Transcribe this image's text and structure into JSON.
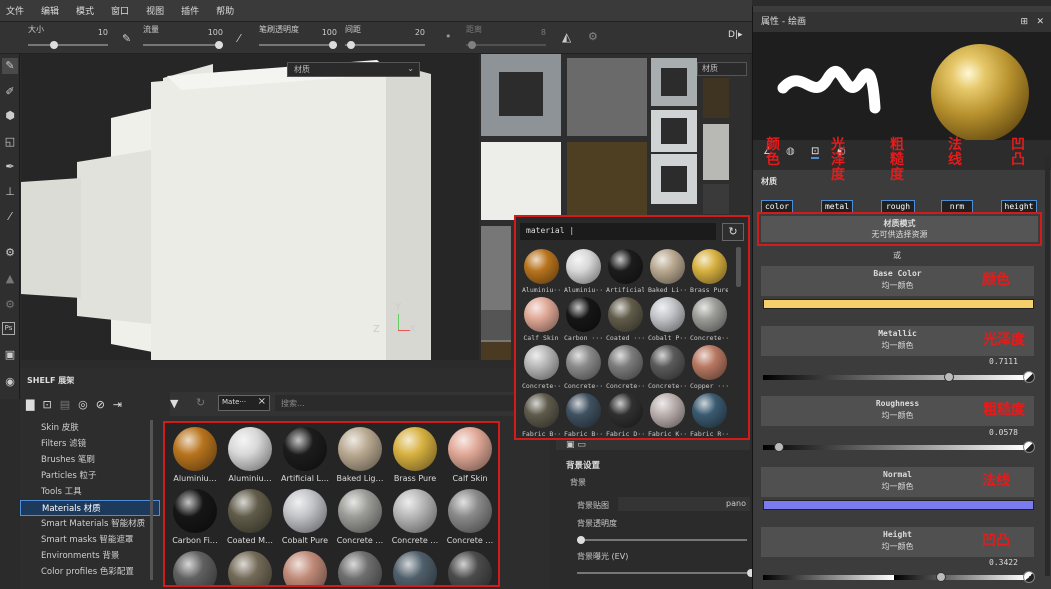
{
  "menu": [
    "文件",
    "编辑",
    "模式",
    "窗口",
    "视图",
    "插件",
    "帮助"
  ],
  "toolbar": {
    "size_label": "大小",
    "size_value": "10",
    "flow_label": "流量",
    "flow_value": "100",
    "stroke_opacity_label": "笔刷透明度",
    "stroke_opacity_value": "100",
    "spacing_label": "间距",
    "spacing_value": "20",
    "distance_label": "距离",
    "distance_value": "8"
  },
  "viewport": {
    "dropdown": "材质",
    "axis_y": "Y",
    "axis_z": "Z",
    "axis_x": "X"
  },
  "uv_view": {
    "dropdown": "材质"
  },
  "shelf": {
    "title": "SHELF 展架",
    "filter_tag": "Mate···",
    "search_placeholder": "搜索...",
    "categories": [
      "Skin 皮肤",
      "Filters 滤镜",
      "Brushes 笔刷",
      "Particles 粒子",
      "Tools 工具",
      "Materials 材质",
      "Smart Materials 智能材质",
      "Smart masks 智能遮罩",
      "Environments 背景",
      "Color profiles 色彩配置"
    ],
    "tiles": [
      {
        "label": "Aluminiu…",
        "color": "#b8741e"
      },
      {
        "label": "Aluminiu…",
        "color": "#d8d8d8"
      },
      {
        "label": "Artificial L…",
        "color": "#1c1c1c"
      },
      {
        "label": "Baked Lig…",
        "color": "#b9a991"
      },
      {
        "label": "Brass Pure",
        "color": "#d7b140"
      },
      {
        "label": "Calf Skin",
        "color": "#e0a896"
      },
      {
        "label": "Carbon Fi…",
        "color": "#161616"
      },
      {
        "label": "Coated M…",
        "color": "#615c4a"
      },
      {
        "label": "Cobalt Pure",
        "color": "#c2c4c8"
      },
      {
        "label": "Concrete …",
        "color": "#9c9c98"
      },
      {
        "label": "Concrete …",
        "color": "#b8b8b8"
      },
      {
        "label": "Concrete …",
        "color": "#8a8a8a"
      },
      {
        "label": "",
        "color": "#606060"
      },
      {
        "label": "",
        "color": "#736957"
      },
      {
        "label": "",
        "color": "#c08a78"
      },
      {
        "label": "",
        "color": "#6e6e6e"
      },
      {
        "label": "",
        "color": "#4f5f6b"
      },
      {
        "label": "",
        "color": "#4b4b4b"
      }
    ]
  },
  "popup": {
    "query": "material |",
    "items": [
      {
        "label": "Aluminiu···",
        "color": "#b8741e"
      },
      {
        "label": "Aluminiu···",
        "color": "#d8d8d8"
      },
      {
        "label": "Artificial",
        "color": "#1c1c1c"
      },
      {
        "label": "Baked Li···",
        "color": "#b9a991"
      },
      {
        "label": "Brass Pure",
        "color": "#d7b140"
      },
      {
        "label": "Calf Skin",
        "color": "#e0a896"
      },
      {
        "label": "Carbon ···",
        "color": "#161616"
      },
      {
        "label": "Coated ···",
        "color": "#615c4a"
      },
      {
        "label": "Cobalt P···",
        "color": "#c2c4c8"
      },
      {
        "label": "Concrete···",
        "color": "#9c9c98"
      },
      {
        "label": "Concrete···",
        "color": "#b8b8b8"
      },
      {
        "label": "Concrete···",
        "color": "#8a8a8a"
      },
      {
        "label": "Concrete···",
        "color": "#7c7c7c"
      },
      {
        "label": "Concrete···",
        "color": "#5a5a5a"
      },
      {
        "label": "Copper ···",
        "color": "#b87862"
      },
      {
        "label": "Fabric B···",
        "color": "#5e5a4c"
      },
      {
        "label": "Fabric B···",
        "color": "#3f5160"
      },
      {
        "label": "Fabric D···",
        "color": "#303030"
      },
      {
        "label": "Fabric K···",
        "color": "#bbb0ae"
      },
      {
        "label": "Fabric R···",
        "color": "#3a5a70"
      }
    ]
  },
  "background": {
    "title": "背景设置",
    "bg": "背景",
    "map_label": "背景贴图",
    "map_value": "pano",
    "opacity_label": "背景透明度",
    "exposure_label": "背景曝光 (EV)"
  },
  "properties": {
    "title": "属性 - 绘画",
    "material_label": "材质",
    "channels": [
      "color",
      "metal",
      "rough",
      "nrm",
      "height"
    ],
    "channel_annotations": [
      "颜色",
      "光泽度",
      "粗糙度",
      "法线",
      "凹凸"
    ],
    "material_mode_title": "材质模式",
    "material_mode_sub": "无可供选择资源",
    "or": "或",
    "base_color": {
      "name": "Base Color",
      "sub": "均一颜色",
      "note": "颜色",
      "swatch": "#f5cf6a"
    },
    "metallic": {
      "name": "Metallic",
      "sub": "均一颜色",
      "note": "光泽度",
      "value": "0.7111",
      "level": 0.71
    },
    "roughness": {
      "name": "Roughness",
      "sub": "均一颜色",
      "note": "粗糙度",
      "value": "0.0578",
      "level": 0.06
    },
    "normal": {
      "name": "Normal",
      "sub": "均一颜色",
      "note": "法线",
      "swatch": "#7b7bf0"
    },
    "height": {
      "name": "Height",
      "sub": "均一颜色",
      "note": "凹凸",
      "value": "0.3422",
      "level": 0.68
    }
  },
  "colors": {
    "highlight": "#d21b1b",
    "accent": "#4d8dd6",
    "annotation": "#e61b1b"
  }
}
